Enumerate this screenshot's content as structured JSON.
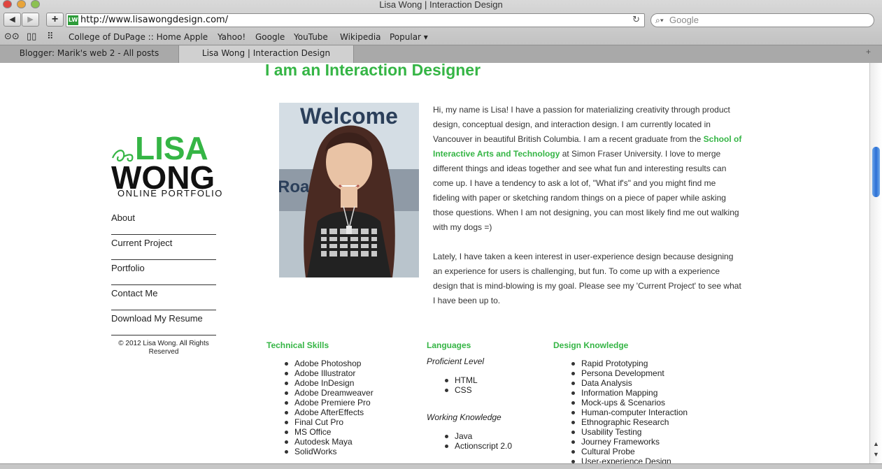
{
  "browser": {
    "window_title": "Lisa Wong | Interaction Design",
    "back_label": "◀",
    "forward_label": "▶",
    "add_label": "+",
    "url": "http://www.lisawongdesign.com/",
    "favicon_text": "LW",
    "search_placeholder": "Google",
    "bookmarks": [
      "College of DuPage :: Home",
      "Apple",
      "Yahoo!",
      "Google",
      "YouTube",
      "Wikipedia",
      "Popular ▾"
    ],
    "tabs": [
      {
        "label": "Blogger: Marik's web 2 - All posts"
      },
      {
        "label": "Lisa Wong | Interaction Design"
      }
    ]
  },
  "page": {
    "heading": "I am an Interaction Designer",
    "logo": {
      "first": "LISA",
      "last": "WONG",
      "sub": "ONLINE PORTFOLIO"
    },
    "nav": [
      "About",
      "Current Project",
      "Portfolio",
      "Contact Me",
      "Download My Resume"
    ],
    "copyright": "© 2012 Lisa Wong. All Rights Reserved",
    "photo_sign": "Welcome",
    "photo_sign2": "Road",
    "bio": {
      "p1_a": "Hi, my name is Lisa! I have a passion for materializing creativity through product design, conceptual design, and interaction design. I am currently located in Vancouver in beautiful British Columbia. I am a recent graduate from the ",
      "p1_link": "School of Interactive Arts and Technology",
      "p1_b": " at Simon Fraser University. I love to merge different things and ideas together and see what fun and interesting results can come up. I have a tendency to ask a lot of, \"What if's\" and you might find me fideling with paper or sketching random things on a piece of paper while asking those questions. When I am not designing, you can most likely find me out walking with my dogs =)",
      "p2": "Lately, I have taken a keen interest in user-experience design because designing an experience for users is challenging, but fun. To come up with a experience design that is mind-blowing is my goal. Please see my 'Current Project' to see what I have been up to."
    },
    "technical": {
      "title": "Technical Skills",
      "items": [
        "Adobe Photoshop",
        "Adobe Illustrator",
        "Adobe InDesign",
        "Adobe Dreamweaver",
        "Adobe Premiere Pro",
        "Adobe AfterEffects",
        "Final Cut Pro",
        "MS Office",
        "Autodesk Maya",
        "SolidWorks"
      ]
    },
    "languages": {
      "title": "Languages",
      "proficient_label": "Proficient Level",
      "proficient": [
        "HTML",
        "CSS"
      ],
      "working_label": "Working Knowledge",
      "working": [
        "Java",
        "Actionscript 2.0"
      ]
    },
    "design": {
      "title": "Design Knowledge",
      "items": [
        "Rapid Prototyping",
        "Persona Development",
        "Data Analysis",
        "Information Mapping",
        "Mock-ups & Scenarios",
        "Human-computer Interaction",
        "Ethnographic Research",
        "Usability Testing",
        "Journey Frameworks",
        "Cultural Probe",
        "User-experience Design"
      ]
    }
  },
  "colors": {
    "accent": "#35b545",
    "scroll_thumb": "#2b6fd6"
  }
}
